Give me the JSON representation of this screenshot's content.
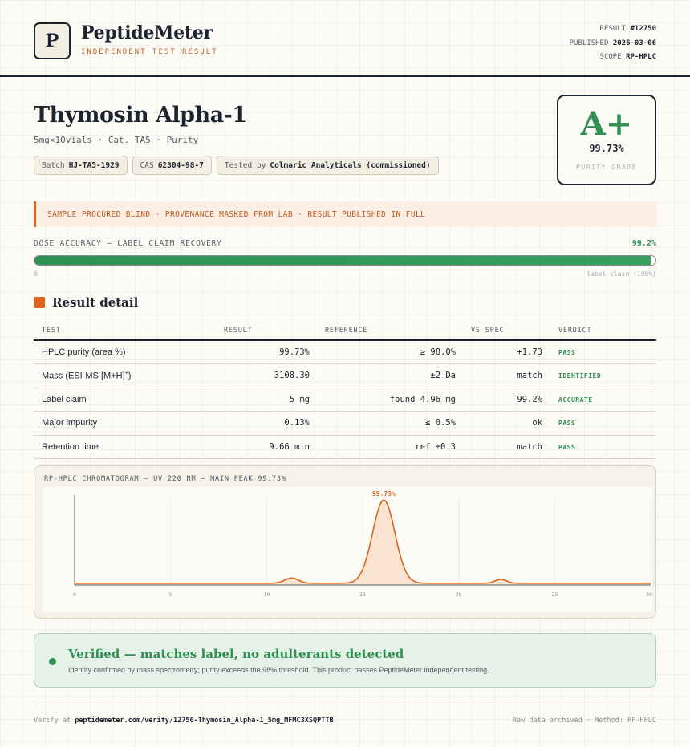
{
  "header": {
    "logo_letter": "P",
    "brand": "PeptideMeter",
    "tagline": "INDEPENDENT TEST RESULT",
    "meta": {
      "result_label": "RESULT",
      "result_value": "#12750",
      "published_label": "PUBLISHED",
      "published_value": "2026-03-06",
      "scope_label": "SCOPE",
      "scope_value": "RP-HPLC"
    }
  },
  "product": {
    "title": "Thymosin Alpha-1",
    "subtitle": "5mg×10vials · Cat. TA5 · Purity",
    "chips": [
      {
        "label": "Batch",
        "value": "HJ-TA5-1929"
      },
      {
        "label": "CAS",
        "value": "62304-98-7"
      },
      {
        "label": "Tested by",
        "value": "Colmaric Analyticals (commissioned)"
      }
    ]
  },
  "grade": {
    "letter": "A+",
    "percent": "99.73%",
    "label": "PURITY GRADE",
    "color": "#2e9152"
  },
  "notice": "SAMPLE PROCURED BLIND · PROVENANCE MASKED FROM LAB · RESULT PUBLISHED IN FULL",
  "dose": {
    "label": "DOSE ACCURACY — LABEL CLAIM RECOVERY",
    "value": "99.2%",
    "fraction": 0.992,
    "min_label": "0",
    "max_label": "label claim (100%)"
  },
  "section": {
    "title": "Result detail"
  },
  "table": {
    "headers": [
      "TEST",
      "RESULT",
      "REFERENCE",
      "VS SPEC",
      "VERDICT"
    ],
    "rows": [
      {
        "test": "HPLC purity (area %)",
        "result": "99.73%",
        "reference": "≥ 98.0%",
        "vs_spec": "+1.73",
        "verdict": "PASS"
      },
      {
        "test": "Mass (ESI-MS [M+H]",
        "test_sup": "+",
        "test_end": ")",
        "result": "3108.30",
        "reference": "±2 Da",
        "vs_spec": "match",
        "verdict": "IDENTIFIED"
      },
      {
        "test": "Label claim",
        "result": "5 mg",
        "reference": "found 4.96 mg",
        "vs_spec": "99.2%",
        "verdict": "ACCURATE"
      },
      {
        "test": "Major impurity",
        "result": "0.13%",
        "reference": "≤ 0.5%",
        "vs_spec": "ok",
        "verdict": "PASS"
      },
      {
        "test": "Retention time",
        "result": "9.66 min",
        "reference": "ref ±0.3",
        "vs_spec": "match",
        "verdict": "PASS"
      }
    ]
  },
  "chart_data": {
    "type": "line",
    "title": "RP-HPLC CHROMATOGRAM — UV 220 NM — MAIN PEAK 99.73%",
    "xlim": [
      0,
      30
    ],
    "ylim": [
      0,
      1
    ],
    "x_ticks": [
      "0",
      "5",
      "10",
      "15",
      "20",
      "25",
      "30m"
    ],
    "peak_label": "99.73%",
    "peaks": [
      {
        "x": 11.3,
        "height": 0.06,
        "width": 0.35
      },
      {
        "x": 16.1,
        "height": 0.96,
        "width": 0.58
      },
      {
        "x": 22.2,
        "height": 0.045,
        "width": 0.3
      }
    ],
    "baseline": 0.02,
    "line_color": "#d96420",
    "fill_color": "#fbe3d2"
  },
  "verified": {
    "title": "Verified — matches label, no adulterants detected",
    "description": "Identity confirmed by mass spectrometry; purity exceeds the 98% threshold. This product passes PeptideMeter independent testing."
  },
  "footer": {
    "verify_prefix": "Verify at",
    "verify_url": "peptidemeter.com/verify/12750-Thymosin_Alpha-1_5mg_MFMC3XSQPTTB",
    "right": "Raw data archived · Method: RP-HPLC"
  }
}
